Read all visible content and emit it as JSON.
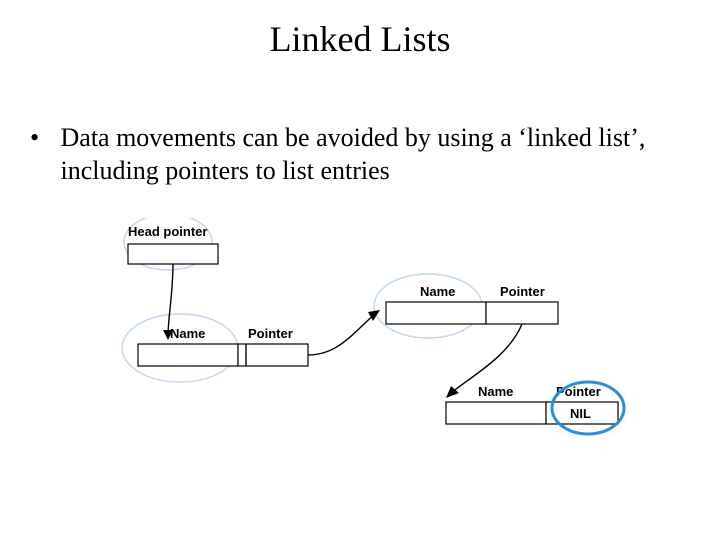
{
  "title": "Linked Lists",
  "bullet": "Data movements can be avoided by using a ‘linked list’, including pointers to list entries",
  "diagram": {
    "head_label": "Head pointer",
    "node1": {
      "name": "Name",
      "pointer": "Pointer"
    },
    "node2": {
      "name": "Name",
      "pointer": "Pointer"
    },
    "node3": {
      "name": "Name",
      "pointer": "Pointer",
      "nil": "NIL"
    }
  }
}
